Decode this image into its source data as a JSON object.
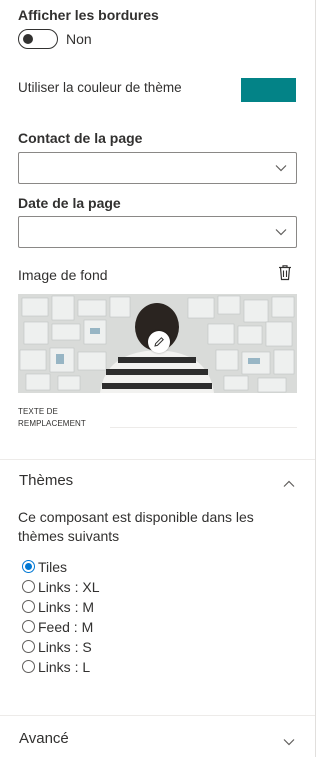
{
  "borders": {
    "label": "Afficher les bordures",
    "toggle_text": "Non",
    "toggle_on": false
  },
  "theme_color": {
    "label": "Utiliser la couleur de thème",
    "color": "#038387"
  },
  "page_contact": {
    "label": "Contact de la page",
    "value": ""
  },
  "page_date": {
    "label": "Date de la page",
    "value": ""
  },
  "background_image": {
    "label": "Image de fond",
    "alt_label": "TEXTE DE REMPLACEMENT",
    "alt_value": ""
  },
  "themes": {
    "title": "Thèmes",
    "description": "Ce composant est disponible dans les thèmes suivants",
    "options": [
      {
        "label": "Tiles",
        "selected": true
      },
      {
        "label": "Links : XL",
        "selected": false
      },
      {
        "label": "Links : M",
        "selected": false
      },
      {
        "label": "Feed : M",
        "selected": false
      },
      {
        "label": "Links : S",
        "selected": false
      },
      {
        "label": "Links : L",
        "selected": false
      }
    ]
  },
  "advanced": {
    "title": "Avancé"
  },
  "icons": [
    "chevron-down-icon",
    "trash-icon",
    "pencil-icon",
    "chevron-up-icon"
  ]
}
